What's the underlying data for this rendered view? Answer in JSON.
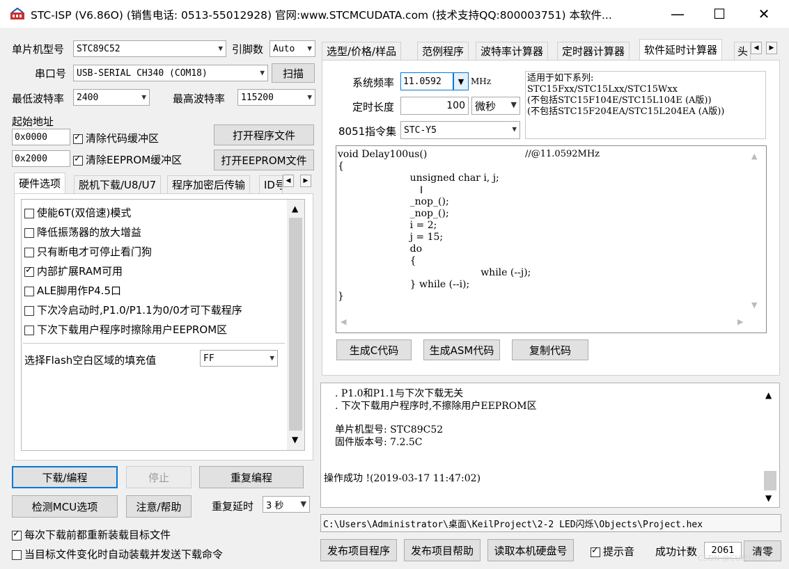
{
  "window": {
    "title": "STC-ISP (V6.86O) (销售电话: 0513-55012928) 官网:www.STCMCUDATA.com  (技术支持QQ:800003751) 本软件...",
    "min": "—",
    "max": "☐",
    "close": "✕"
  },
  "left": {
    "mcu_model_label": "单片机型号",
    "mcu_model_value": "STC89C52",
    "pin_count_label": "引脚数",
    "pin_count_value": "Auto",
    "port_label": "串口号",
    "port_value": "USB-SERIAL CH340 (COM18)",
    "scan": "扫描",
    "min_baud_label": "最低波特率",
    "min_baud_value": "2400",
    "max_baud_label": "最高波特率",
    "max_baud_value": "115200",
    "start_addr_label": "起始地址",
    "addr1": "0x0000",
    "clear_code": "清除代码缓冲区",
    "open_program": "打开程序文件",
    "addr2": "0x2000",
    "clear_eeprom": "清除EEPROM缓冲区",
    "open_eeprom": "打开EEPROM文件",
    "tabs": [
      "硬件选项",
      "脱机下载/U8/U7",
      "程序加密后传输",
      "ID号"
    ],
    "options": [
      {
        "label": "使能6T(双倍速)模式",
        "checked": false
      },
      {
        "label": "降低振荡器的放大增益",
        "checked": false
      },
      {
        "label": "只有断电才可停止看门狗",
        "checked": false
      },
      {
        "label": "内部扩展RAM可用",
        "checked": true
      },
      {
        "label": "ALE脚用作P4.5口",
        "checked": false
      },
      {
        "label": "下次冷启动时,P1.0/P1.1为0/0才可下载程序",
        "checked": false
      },
      {
        "label": "下次下载用户程序时擦除用户EEPROM区",
        "checked": false
      }
    ],
    "fill_label": "选择Flash空白区域的填充值",
    "fill_value": "FF",
    "download": "下载/编程",
    "stop": "停止",
    "reprogram": "重复编程",
    "check_mcu": "检测MCU选项",
    "help": "注意/帮助",
    "repeat_delay_label": "重复延时",
    "repeat_delay_value": "3 秒",
    "reload_each": "每次下载前都重新装载目标文件",
    "auto_reload": "当目标文件变化时自动装载并发送下载命令"
  },
  "right": {
    "tabs": [
      "选型/价格/样品",
      "范例程序",
      "波特率计算器",
      "定时器计算器",
      "软件延时计算器",
      "头"
    ],
    "sys_freq_label": "系统频率",
    "sys_freq_value": "11.0592",
    "sys_freq_unit": "MHz",
    "delay_len_label": "定时长度",
    "delay_len_value": "100",
    "delay_unit": "微秒",
    "instr_label": "8051指令集",
    "instr_value": "STC-Y5",
    "series_text": [
      "适用于如下系列:",
      "STC15Fxx/STC15Lxx/STC15Wxx",
      "(不包括STC15F104E/STC15L104E (A版))",
      "(不包括STC15F204EA/STC15L204EA (A版))"
    ],
    "code": [
      "void Delay100us()\t\t//@11.0592MHz",
      "{",
      "\tunsigned char i, j;",
      "",
      "\t_nop_();",
      "\t_nop_();",
      "\ti = 2;",
      "\tj = 15;",
      "\tdo",
      "\t{",
      "\t\twhile (--j);",
      "\t} while (--i);",
      "}"
    ],
    "gen_c": "生成C代码",
    "gen_asm": "生成ASM代码",
    "copy_code": "复制代码",
    "log": [
      ". P1.0和P1.1与下次下载无关",
      ". 下次下载用户程序时,不擦除用户EEPROM区",
      "",
      "单片机型号: STC89C52",
      "固件版本号: 7.2.5C",
      "",
      "",
      "操作成功 !(2019-03-17 11:47:02)"
    ],
    "path": "C:\\Users\\Administrator\\桌面\\KeilProject\\2-2 LED闪烁\\Objects\\Project.hex",
    "publish_program": "发布项目程序",
    "publish_help": "发布项目帮助",
    "read_hdd": "读取本机硬盘号",
    "beep_label": "提示音",
    "success_count_label": "成功计数",
    "success_count_value": "2061",
    "clear": "清零"
  },
  "watermark": "CSDN @CUMTB-YF"
}
